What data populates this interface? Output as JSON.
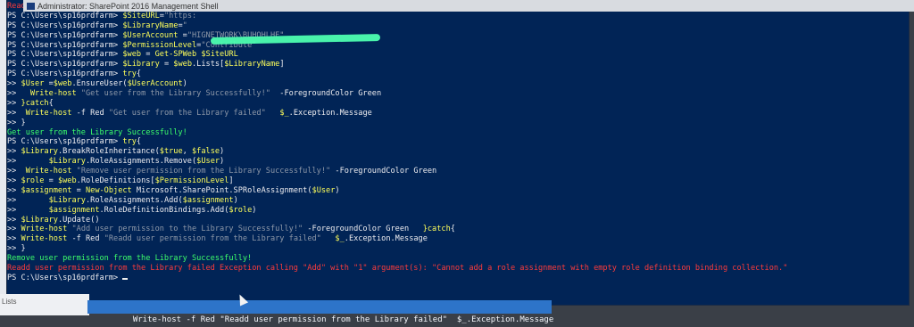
{
  "window": {
    "title": "Administrator: SharePoint 2016 Management Shell",
    "background_color": "#012456",
    "side_label_1": "Fi",
    "side_label_2": "W",
    "side_label_3": "W",
    "side_label_lists": "Lists"
  },
  "console": {
    "lines": [
      {
        "text": "Readd user permission from the Library failed Exception calling \"Add\" with \"1\" argument(s): \"Cannot add a role assignment with empty role definition binding collection.\"",
        "color": "red"
      },
      {
        "text": "PS C:\\Users\\sp16prdfarm> $SiteURL=\"https:",
        "color": "mixed",
        "segments": [
          [
            "w",
            "PS C:\\Users\\sp16prdfarm> "
          ],
          [
            "y",
            "$SiteURL"
          ],
          [
            "w",
            "="
          ],
          [
            "gy",
            "\"https:"
          ]
        ]
      },
      {
        "text": "PS C:\\Users\\sp16prdfarm> $LibraryName=\"",
        "color": "mixed",
        "segments": [
          [
            "w",
            "PS C:\\Users\\sp16prdfarm> "
          ],
          [
            "y",
            "$LibraryName"
          ],
          [
            "w",
            "="
          ],
          [
            "gy",
            "\""
          ]
        ]
      },
      {
        "text": "PS C:\\Users\\sp16prdfarm> $UserAccount =\"HIGNETWORK\\BUHOHLHE\"",
        "color": "mixed",
        "segments": [
          [
            "w",
            "PS C:\\Users\\sp16prdfarm> "
          ],
          [
            "y",
            "$UserAccount"
          ],
          [
            "w",
            " ="
          ],
          [
            "gy",
            "\"HIGNETWORK\\BUHOHLHE\""
          ]
        ]
      },
      {
        "text": "PS C:\\Users\\sp16prdfarm> $PermissionLevel=\"Contribute\"",
        "color": "mixed",
        "segments": [
          [
            "w",
            "PS C:\\Users\\sp16prdfarm> "
          ],
          [
            "y",
            "$PermissionLevel"
          ],
          [
            "w",
            "="
          ],
          [
            "gy",
            "\"Contribute\""
          ]
        ]
      },
      {
        "text": "PS C:\\Users\\sp16prdfarm> $web = Get-SPWeb $SiteURL",
        "color": "mixed",
        "segments": [
          [
            "w",
            "PS C:\\Users\\sp16prdfarm> "
          ],
          [
            "y",
            "$web"
          ],
          [
            "w",
            " = "
          ],
          [
            "y",
            "Get-SPWeb"
          ],
          [
            "w",
            " "
          ],
          [
            "y",
            "$SiteURL"
          ]
        ]
      },
      {
        "text": "PS C:\\Users\\sp16prdfarm> $Library = $web.Lists[$LibraryName]",
        "color": "mixed",
        "segments": [
          [
            "w",
            "PS C:\\Users\\sp16prdfarm> "
          ],
          [
            "y",
            "$Library"
          ],
          [
            "w",
            " = "
          ],
          [
            "y",
            "$web"
          ],
          [
            "w",
            ".Lists["
          ],
          [
            "y",
            "$LibraryName"
          ],
          [
            "w",
            "]"
          ]
        ]
      },
      {
        "text": "PS C:\\Users\\sp16prdfarm> try{",
        "color": "mixed",
        "segments": [
          [
            "w",
            "PS C:\\Users\\sp16prdfarm> "
          ],
          [
            "y",
            "try"
          ],
          [
            "w",
            "{"
          ]
        ]
      },
      {
        "text": ">> $User =$web.EnsureUser($UserAccount)",
        "color": "mixed",
        "segments": [
          [
            "w",
            ">> "
          ],
          [
            "y",
            "$User"
          ],
          [
            "w",
            " ="
          ],
          [
            "y",
            "$web"
          ],
          [
            "w",
            ".EnsureUser("
          ],
          [
            "y",
            "$UserAccount"
          ],
          [
            "w",
            ")"
          ]
        ]
      },
      {
        "text": ">>   Write-host \"Get user from the Library Successfully!\"  -ForegroundColor Green",
        "color": "mixed",
        "segments": [
          [
            "w",
            ">>   "
          ],
          [
            "y",
            "Write-host"
          ],
          [
            "w",
            " "
          ],
          [
            "gy",
            "\"Get user from the Library Successfully!\""
          ],
          [
            "w",
            "  -ForegroundColor Green"
          ]
        ]
      },
      {
        "text": ">> }catch{",
        "color": "mixed",
        "segments": [
          [
            "w",
            ">> "
          ],
          [
            "y",
            "}catch"
          ],
          [
            "w",
            "{"
          ]
        ]
      },
      {
        "text": ">>  Write-host -f Red \"Get user from the Library failed\"   $_.Exception.Message",
        "color": "mixed",
        "segments": [
          [
            "w",
            ">>  "
          ],
          [
            "y",
            "Write-host"
          ],
          [
            "w",
            " -f Red "
          ],
          [
            "gy",
            "\"Get user from the Library failed\""
          ],
          [
            "w",
            "   "
          ],
          [
            "y",
            "$_"
          ],
          [
            "w",
            ".Exception.Message"
          ]
        ]
      },
      {
        "text": ">> }",
        "color": "white"
      },
      {
        "text": "Get user from the Library Successfully!",
        "color": "green"
      },
      {
        "text": "PS C:\\Users\\sp16prdfarm> try{",
        "color": "mixed",
        "segments": [
          [
            "w",
            "PS C:\\Users\\sp16prdfarm> "
          ],
          [
            "y",
            "try"
          ],
          [
            "w",
            "{"
          ]
        ]
      },
      {
        "text": ">> $Library.BreakRoleInheritance($true, $false)",
        "color": "mixed",
        "segments": [
          [
            "w",
            ">> "
          ],
          [
            "y",
            "$Library"
          ],
          [
            "w",
            ".BreakRoleInheritance("
          ],
          [
            "y",
            "$true"
          ],
          [
            "w",
            ", "
          ],
          [
            "y",
            "$false"
          ],
          [
            "w",
            ")"
          ]
        ]
      },
      {
        "text": ">>       $Library.RoleAssignments.Remove($User)",
        "color": "mixed",
        "segments": [
          [
            "w",
            ">>       "
          ],
          [
            "y",
            "$Library"
          ],
          [
            "w",
            ".RoleAssignments.Remove("
          ],
          [
            "y",
            "$User"
          ],
          [
            "w",
            ")"
          ]
        ]
      },
      {
        "text": ">>  Write-host \"Remove user permission from the Library Successfully!\" -ForegroundColor Green",
        "color": "mixed",
        "segments": [
          [
            "w",
            ">>  "
          ],
          [
            "y",
            "Write-host"
          ],
          [
            "w",
            " "
          ],
          [
            "gy",
            "\"Remove user permission from the Library Successfully!\""
          ],
          [
            "w",
            " -ForegroundColor Green"
          ]
        ]
      },
      {
        "text": ">> $role = $web.RoleDefinitions[$PermissionLevel]",
        "color": "mixed",
        "segments": [
          [
            "w",
            ">> "
          ],
          [
            "y",
            "$role"
          ],
          [
            "w",
            " = "
          ],
          [
            "y",
            "$web"
          ],
          [
            "w",
            ".RoleDefinitions["
          ],
          [
            "y",
            "$PermissionLevel"
          ],
          [
            "w",
            "]"
          ]
        ]
      },
      {
        "text": ">> $assignment = New-Object Microsoft.SharePoint.SPRoleAssignment($User)",
        "color": "mixed",
        "segments": [
          [
            "w",
            ">> "
          ],
          [
            "y",
            "$assignment"
          ],
          [
            "w",
            " = "
          ],
          [
            "y",
            "New-Object"
          ],
          [
            "w",
            " Microsoft.SharePoint.SPRoleAssignment("
          ],
          [
            "y",
            "$User"
          ],
          [
            "w",
            ")"
          ]
        ]
      },
      {
        "text": ">>       $Library.RoleAssignments.Add($assignment)",
        "color": "mixed",
        "segments": [
          [
            "w",
            ">>       "
          ],
          [
            "y",
            "$Library"
          ],
          [
            "w",
            ".RoleAssignments.Add("
          ],
          [
            "y",
            "$assignment"
          ],
          [
            "w",
            ")"
          ]
        ]
      },
      {
        "text": ">>       $assignment.RoleDefinitionBindings.Add($role)",
        "color": "mixed",
        "segments": [
          [
            "w",
            ">>       "
          ],
          [
            "y",
            "$assignment"
          ],
          [
            "w",
            ".RoleDefinitionBindings.Add("
          ],
          [
            "y",
            "$role"
          ],
          [
            "w",
            ")"
          ]
        ]
      },
      {
        "text": ">> $Library.Update()",
        "color": "mixed",
        "segments": [
          [
            "w",
            ">> "
          ],
          [
            "y",
            "$Library"
          ],
          [
            "w",
            ".Update()"
          ]
        ]
      },
      {
        "text": ">> Write-host \"Add user permission to the Library Successfully!\" -ForegroundColor Green   }catch{",
        "color": "mixed",
        "segments": [
          [
            "w",
            ">> "
          ],
          [
            "y",
            "Write-host"
          ],
          [
            "w",
            " "
          ],
          [
            "gy",
            "\"Add user permission to the Library Successfully!\""
          ],
          [
            "w",
            " -ForegroundColor Green   "
          ],
          [
            "y",
            "}catch"
          ],
          [
            "w",
            "{"
          ]
        ]
      },
      {
        "text": ">> Write-host -f Red \"Readd user permission from the Library failed\"   $_.Exception.Message",
        "color": "mixed",
        "segments": [
          [
            "w",
            ">> "
          ],
          [
            "y",
            "Write-host"
          ],
          [
            "w",
            " -f Red "
          ],
          [
            "gy",
            "\"Readd user permission from the Library failed\""
          ],
          [
            "w",
            "   "
          ],
          [
            "y",
            "$_"
          ],
          [
            "w",
            ".Exception.Message"
          ]
        ]
      },
      {
        "text": ">> }",
        "color": "white"
      },
      {
        "text": "Remove user permission from the Library Successfully!",
        "color": "green"
      },
      {
        "text": "Readd user permission from the Library failed Exception calling \"Add\" with \"1\" argument(s): \"Cannot add a role assignment with empty role definition binding collection.\"",
        "color": "red"
      },
      {
        "text": "PS C:\\Users\\sp16prdfarm> ",
        "color": "white",
        "cursor": true
      }
    ],
    "colors": {
      "white": "#eeedf0",
      "yellow": "#ffff5a",
      "red": "#ff3b3b",
      "green": "#3dff6a",
      "gray": "#8e98a8"
    }
  },
  "suggestion_bar": {
    "text": "Write-host -f Red \"Readd user permission from the Library failed\"  $_.Exception.Message",
    "background": "#2d74c9"
  }
}
